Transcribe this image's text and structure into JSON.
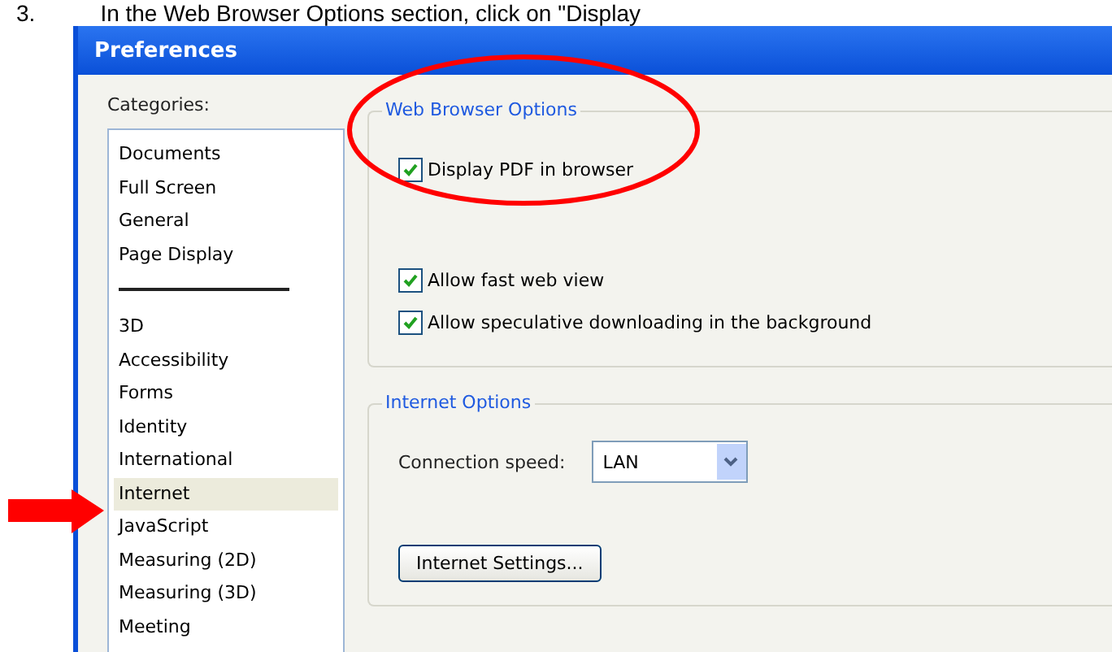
{
  "instruction": {
    "number": "3.",
    "text": "In the Web Browser Options section, click on \"Display"
  },
  "window": {
    "title": "Preferences"
  },
  "categories": {
    "label": "Categories:",
    "groups": [
      [
        {
          "label": "Documents",
          "selected": false
        },
        {
          "label": "Full Screen",
          "selected": false
        },
        {
          "label": "General",
          "selected": false
        },
        {
          "label": "Page Display",
          "selected": false
        }
      ],
      [
        {
          "label": "3D",
          "selected": false
        },
        {
          "label": "Accessibility",
          "selected": false
        },
        {
          "label": "Forms",
          "selected": false
        },
        {
          "label": "Identity",
          "selected": false
        },
        {
          "label": "International",
          "selected": false
        },
        {
          "label": "Internet",
          "selected": true
        },
        {
          "label": "JavaScript",
          "selected": false
        },
        {
          "label": "Measuring (2D)",
          "selected": false
        },
        {
          "label": "Measuring (3D)",
          "selected": false
        },
        {
          "label": "Meeting",
          "selected": false
        }
      ]
    ]
  },
  "web_browser_options": {
    "title": "Web Browser Options",
    "option_groups": [
      [
        {
          "label": "Display PDF in browser",
          "checked": true
        }
      ],
      [
        {
          "label": "Allow fast web view",
          "checked": true
        },
        {
          "label": "Allow speculative downloading in the background",
          "checked": true
        }
      ]
    ]
  },
  "internet_options": {
    "title": "Internet Options",
    "connection_speed": {
      "label": "Connection speed:",
      "value": "LAN"
    },
    "button": "Internet Settings..."
  }
}
